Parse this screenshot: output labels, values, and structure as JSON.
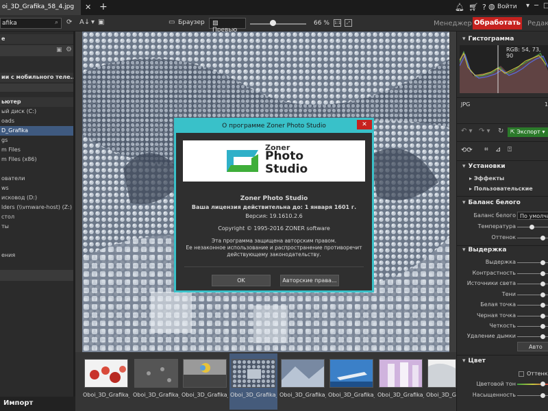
{
  "window": {
    "tab_title": "oi_3D_Grafika_58_4.jpg",
    "login_label": "Войти"
  },
  "toolbar": {
    "search_value": "afika",
    "browser_label": "Браузер",
    "preview_label": "Превью",
    "zoom_value": "66 %",
    "zoom_fraction": 0.4,
    "one_to_one": "1:1",
    "manager_label": "Менеджер",
    "process_label": "Обработать",
    "edit_label": "Редакти"
  },
  "left_panel": {
    "rows": [
      {
        "text": "е",
        "kind": "head"
      },
      {
        "text": "ии с мобильного теле...",
        "kind": "head"
      },
      {
        "text": "ьютер",
        "kind": "head"
      },
      {
        "text": "ый диск (C:)",
        "kind": "item"
      },
      {
        "text": "oads",
        "kind": "item"
      },
      {
        "text": "D_Grafika",
        "kind": "selected"
      },
      {
        "text": "gs",
        "kind": "item"
      },
      {
        "text": "m Files",
        "kind": "item"
      },
      {
        "text": "m Files (x86)",
        "kind": "item"
      },
      {
        "text": "ователи",
        "kind": "item"
      },
      {
        "text": "ws",
        "kind": "item"
      },
      {
        "text": "исковод (D:)",
        "kind": "item"
      },
      {
        "text": "lders (\\\\vmware-host) (Z:)",
        "kind": "item"
      },
      {
        "text": "стол",
        "kind": "item"
      },
      {
        "text": "ты",
        "kind": "item"
      },
      {
        "text": "ения",
        "kind": "item"
      }
    ],
    "import_label": "Импорт"
  },
  "filmstrip": {
    "label": "Oboi_3D_Grafika_",
    "selected_index": 3
  },
  "dialog": {
    "title": "О программе Zoner Photo Studio",
    "logo_word1": "Zoner",
    "logo_word2": "Photo",
    "logo_word3": "Studio",
    "product_name": "Zoner Photo Studio",
    "license": "Ваша лицензия действительна до: 1 января 1601 г.",
    "version": "Версия: 19.1610.2.6",
    "copyright": "Copyright © 1995-2016 ZONER software",
    "legal_line1": "Эта программа защищена авторским правом.",
    "legal_line2": "Ее незаконное использование и распространение противоречит",
    "legal_line3": "действующему законодательству.",
    "ok_label": "OK",
    "copyright_button": "Авторские права..."
  },
  "right_panel": {
    "histogram_title": "Гистограмма",
    "rgb_readout": "RGB: 54, 73, 90",
    "file_type": "JPG",
    "file_size_digit": "1",
    "export_label": "Экспорт",
    "settings_title": "Установки",
    "effects_label": "Эффекты",
    "custom_label": "Пользовательские",
    "wb_title": "Баланс белого",
    "wb_label": "Баланс белого",
    "wb_value": "По умолча",
    "temperature_label": "Температура",
    "tint_label": "Оттенок",
    "exposure_title": "Выдержка",
    "exposure_sliders": [
      "Выдержка",
      "Контрастность",
      "Источники света",
      "Тени",
      "Белая точка",
      "Черная точка",
      "Четкость",
      "Удаление дымки"
    ],
    "auto_label": "Авто",
    "color_title": "Цвет",
    "tones_label": "Оттенки",
    "hue_label": "Цветовой тон",
    "saturation_label": "Насыщенность"
  }
}
